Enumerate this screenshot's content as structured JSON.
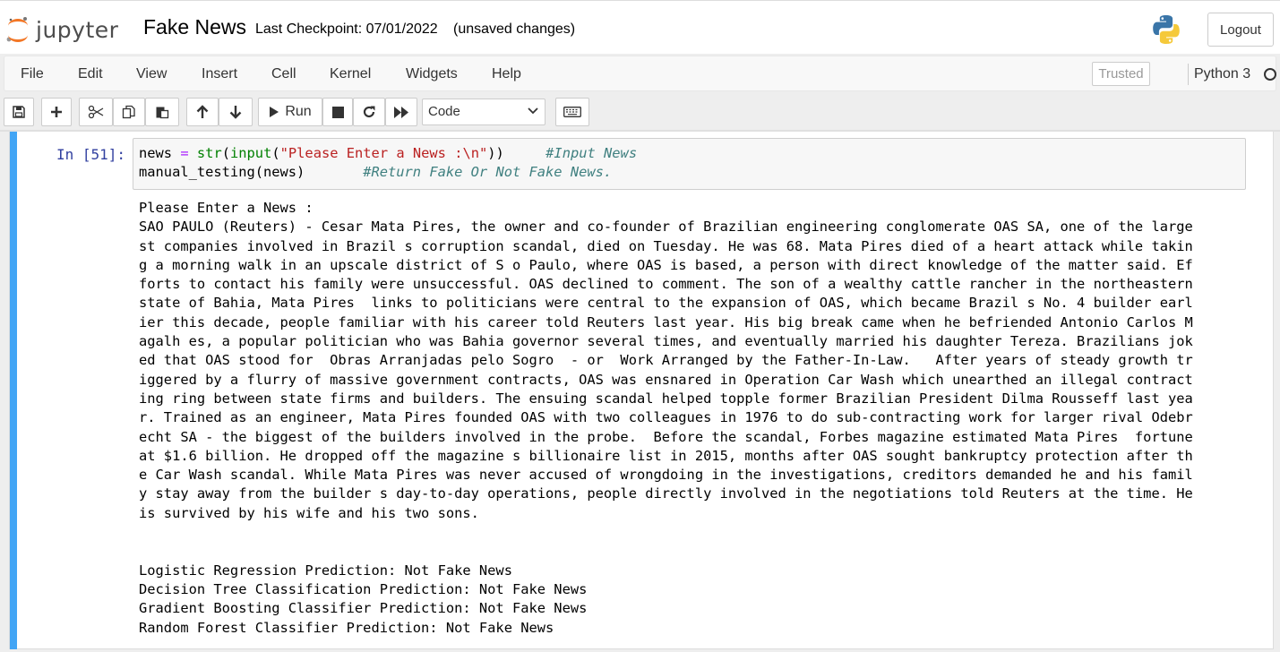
{
  "header": {
    "logo_text": "jupyter",
    "notebook_name": "Fake News",
    "checkpoint": "Last Checkpoint: 07/01/2022",
    "unsaved": "(unsaved changes)",
    "logout_label": "Logout"
  },
  "menu": {
    "items": [
      "File",
      "Edit",
      "View",
      "Insert",
      "Cell",
      "Kernel",
      "Widgets",
      "Help"
    ],
    "trusted_label": "Trusted",
    "kernel_name": "Python 3"
  },
  "toolbar": {
    "run_label": "Run",
    "cell_type": "Code",
    "icons": [
      "save-icon",
      "plus-icon",
      "cut-icon",
      "copy-icon",
      "paste-icon",
      "arrow-up-icon",
      "arrow-down-icon",
      "play-icon",
      "stop-icon",
      "restart-icon",
      "fast-forward-icon",
      "keyboard-icon"
    ]
  },
  "cell": {
    "prompt": "In [51]:",
    "code": {
      "line1": {
        "p1": "news ",
        "p2": "=",
        "p3": " ",
        "p4": "str",
        "p5": "(",
        "p6": "input",
        "p7": "(",
        "p8": "\"Please Enter a News :\\n\"",
        "p9": "))     ",
        "p10": "#Input News"
      },
      "line2": {
        "p1": "manual_testing(news)       ",
        "p2": "#Return Fake Or Not Fake News."
      }
    },
    "output_lines": [
      "Please Enter a News :",
      "SAO PAULO (Reuters) - Cesar Mata Pires, the owner and co-founder of Brazilian engineering conglomerate OAS SA, one of the large",
      "st companies involved in Brazil s corruption scandal, died on Tuesday. He was 68. Mata Pires died of a heart attack while takin",
      "g a morning walk in an upscale district of S o Paulo, where OAS is based, a person with direct knowledge of the matter said. Ef",
      "forts to contact his family were unsuccessful. OAS declined to comment. The son of a wealthy cattle rancher in the northeastern",
      "state of Bahia, Mata Pires  links to politicians were central to the expansion of OAS, which became Brazil s No. 4 builder earl",
      "ier this decade, people familiar with his career told Reuters last year. His big break came when he befriended Antonio Carlos M",
      "agalh es, a popular politician who was Bahia governor several times, and eventually married his daughter Tereza. Brazilians jok",
      "ed that OAS stood for  Obras Arranjadas pelo Sogro  - or  Work Arranged by the Father-In-Law.   After years of steady growth tr",
      "iggered by a flurry of massive government contracts, OAS was ensnared in Operation Car Wash which unearthed an illegal contract",
      "ing ring between state firms and builders. The ensuing scandal helped topple former Brazilian President Dilma Rousseff last yea",
      "r. Trained as an engineer, Mata Pires founded OAS with two colleagues in 1976 to do sub-contracting work for larger rival Odebr",
      "echt SA - the biggest of the builders involved in the probe.  Before the scandal, Forbes magazine estimated Mata Pires  fortune",
      "at $1.6 billion. He dropped off the magazine s billionaire list in 2015, months after OAS sought bankruptcy protection after th",
      "e Car Wash scandal. While Mata Pires was never accused of wrongdoing in the investigations, creditors demanded he and his famil",
      "y stay away from the builder s day-to-day operations, people directly involved in the negotiations told Reuters at the time. He",
      "is survived by his wife and his two sons.",
      "",
      "",
      "Logistic Regression Prediction: Not Fake News",
      "Decision Tree Classification Prediction: Not Fake News",
      "Gradient Boosting Classifier Prediction: Not Fake News",
      "Random Forest Classifier Prediction: Not Fake News"
    ]
  },
  "colors": {
    "selected_cell_bar": "#42a5f5",
    "prompt": "#303f9f"
  }
}
